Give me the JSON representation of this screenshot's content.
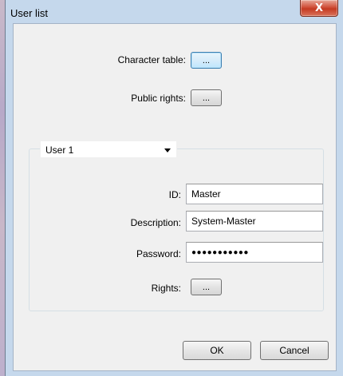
{
  "window": {
    "title": "User list",
    "close_glyph": "X"
  },
  "character_table": {
    "label": "Character table:",
    "button": "..."
  },
  "public_rights": {
    "label": "Public rights:",
    "button": "..."
  },
  "user_selector": {
    "selected": "User 1"
  },
  "form": {
    "id_label": "ID:",
    "id_value": "Master",
    "description_label": "Description:",
    "description_value": "System-Master",
    "password_label": "Password:",
    "password_value": "●●●●●●●●●●●",
    "rights_label": "Rights:",
    "rights_button": "..."
  },
  "buttons": {
    "ok": "OK",
    "cancel": "Cancel"
  }
}
